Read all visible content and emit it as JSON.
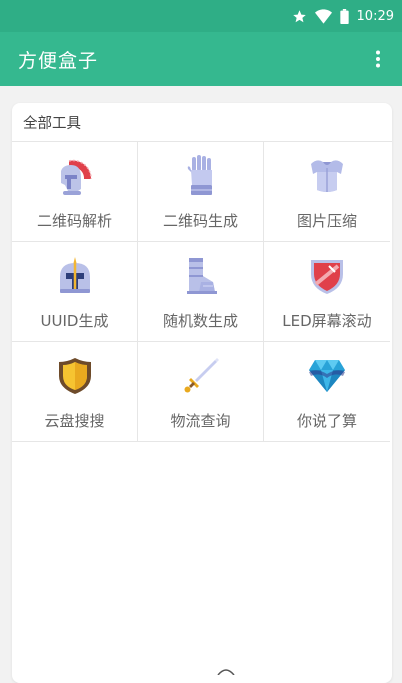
{
  "status_bar": {
    "time": "10:29",
    "icons": [
      "star-icon",
      "wifi-icon",
      "battery-icon"
    ]
  },
  "app_bar": {
    "title": "方便盒子",
    "menu_icon": "more-vert-icon"
  },
  "section": {
    "title": "全部工具"
  },
  "tools": [
    {
      "label": "二维码解析",
      "icon": "spartan-helmet-icon"
    },
    {
      "label": "二维码生成",
      "icon": "gauntlet-icon"
    },
    {
      "label": "图片压缩",
      "icon": "armor-chest-icon"
    },
    {
      "label": "UUID生成",
      "icon": "knight-helmet-icon"
    },
    {
      "label": "随机数生成",
      "icon": "armor-boot-icon"
    },
    {
      "label": "LED屏幕滚动",
      "icon": "red-shield-icon"
    },
    {
      "label": "云盘搜搜",
      "icon": "gold-shield-icon"
    },
    {
      "label": "物流查询",
      "icon": "sword-icon"
    },
    {
      "label": "你说了算",
      "icon": "crystal-icon"
    }
  ],
  "colors": {
    "status_bar": "#2fae86",
    "app_bar": "#35b88f",
    "background": "#f2f2f2"
  }
}
